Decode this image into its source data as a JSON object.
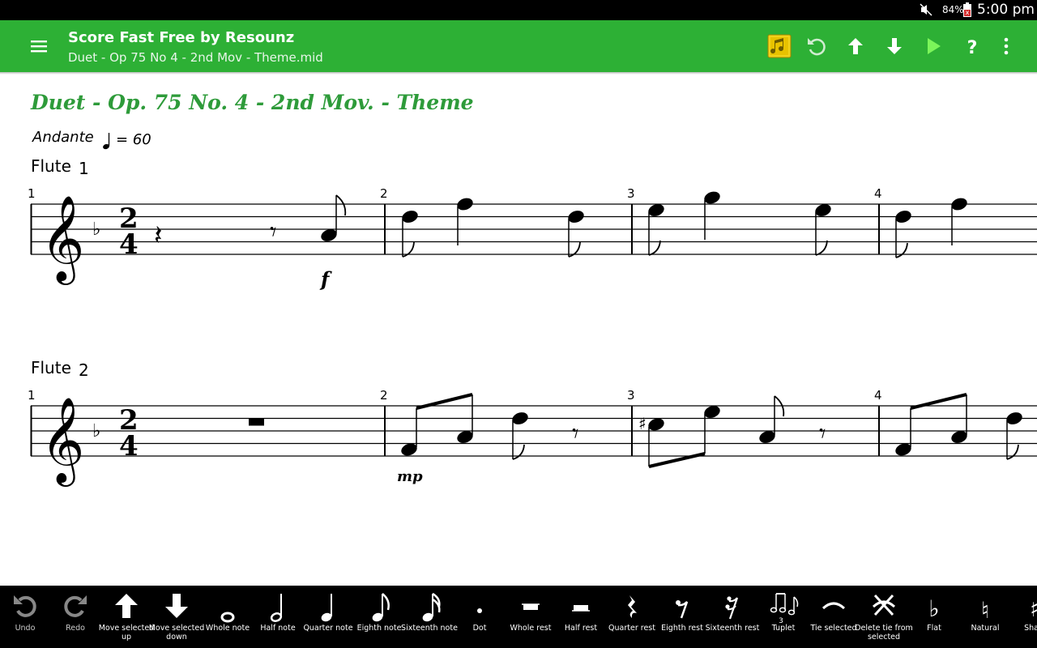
{
  "status": {
    "battery": "84%",
    "time": "5:00 pm"
  },
  "appbar": {
    "title": "Score Fast Free by Resounz",
    "subtitle": "Duet - Op 75 No 4 - 2nd Mov - Theme.mid",
    "actions": [
      "library-icon",
      "undo-icon",
      "move-up-icon",
      "move-down-icon",
      "play-icon",
      "help-icon",
      "more-icon"
    ]
  },
  "score": {
    "title": "Duet - Op. 75 No. 4 - 2nd Mov. - Theme",
    "tempo_text": "Andante",
    "tempo_value": "= 60",
    "time_signature": "2/4",
    "key": "F major (1 flat)",
    "staves": [
      {
        "name": "Flute",
        "number": "1",
        "measures": [
          "1",
          "2",
          "3",
          "4"
        ],
        "dynamic": "f"
      },
      {
        "name": "Flute",
        "number": "2",
        "measures": [
          "1",
          "2",
          "3",
          "4"
        ],
        "dynamic": "mp"
      }
    ]
  },
  "toolbar": {
    "items": [
      {
        "key": "undo",
        "label": "Undo"
      },
      {
        "key": "redo",
        "label": "Redo"
      },
      {
        "key": "move-up",
        "label": "Move selected up"
      },
      {
        "key": "move-down",
        "label": "Move selected down"
      },
      {
        "key": "whole-note",
        "label": "Whole note"
      },
      {
        "key": "half-note",
        "label": "Half note"
      },
      {
        "key": "quarter-note",
        "label": "Quarter note"
      },
      {
        "key": "eighth-note",
        "label": "Eighth note"
      },
      {
        "key": "sixteenth-note",
        "label": "Sixteenth note"
      },
      {
        "key": "dot",
        "label": "Dot"
      },
      {
        "key": "whole-rest",
        "label": "Whole rest"
      },
      {
        "key": "half-rest",
        "label": "Half rest"
      },
      {
        "key": "quarter-rest",
        "label": "Quarter rest"
      },
      {
        "key": "eighth-rest",
        "label": "Eighth rest"
      },
      {
        "key": "sixteenth-rest",
        "label": "Sixteenth rest"
      },
      {
        "key": "tuplet",
        "label": "Tuplet"
      },
      {
        "key": "tie",
        "label": "Tie selected"
      },
      {
        "key": "delete-tie",
        "label": "Delete tie from selected"
      },
      {
        "key": "flat",
        "label": "Flat"
      },
      {
        "key": "natural",
        "label": "Natural"
      },
      {
        "key": "sharp",
        "label": "Sharp"
      }
    ]
  },
  "colors": {
    "appbar": "#2db035",
    "title": "#2e9b3a",
    "toolbar": "#000000"
  }
}
